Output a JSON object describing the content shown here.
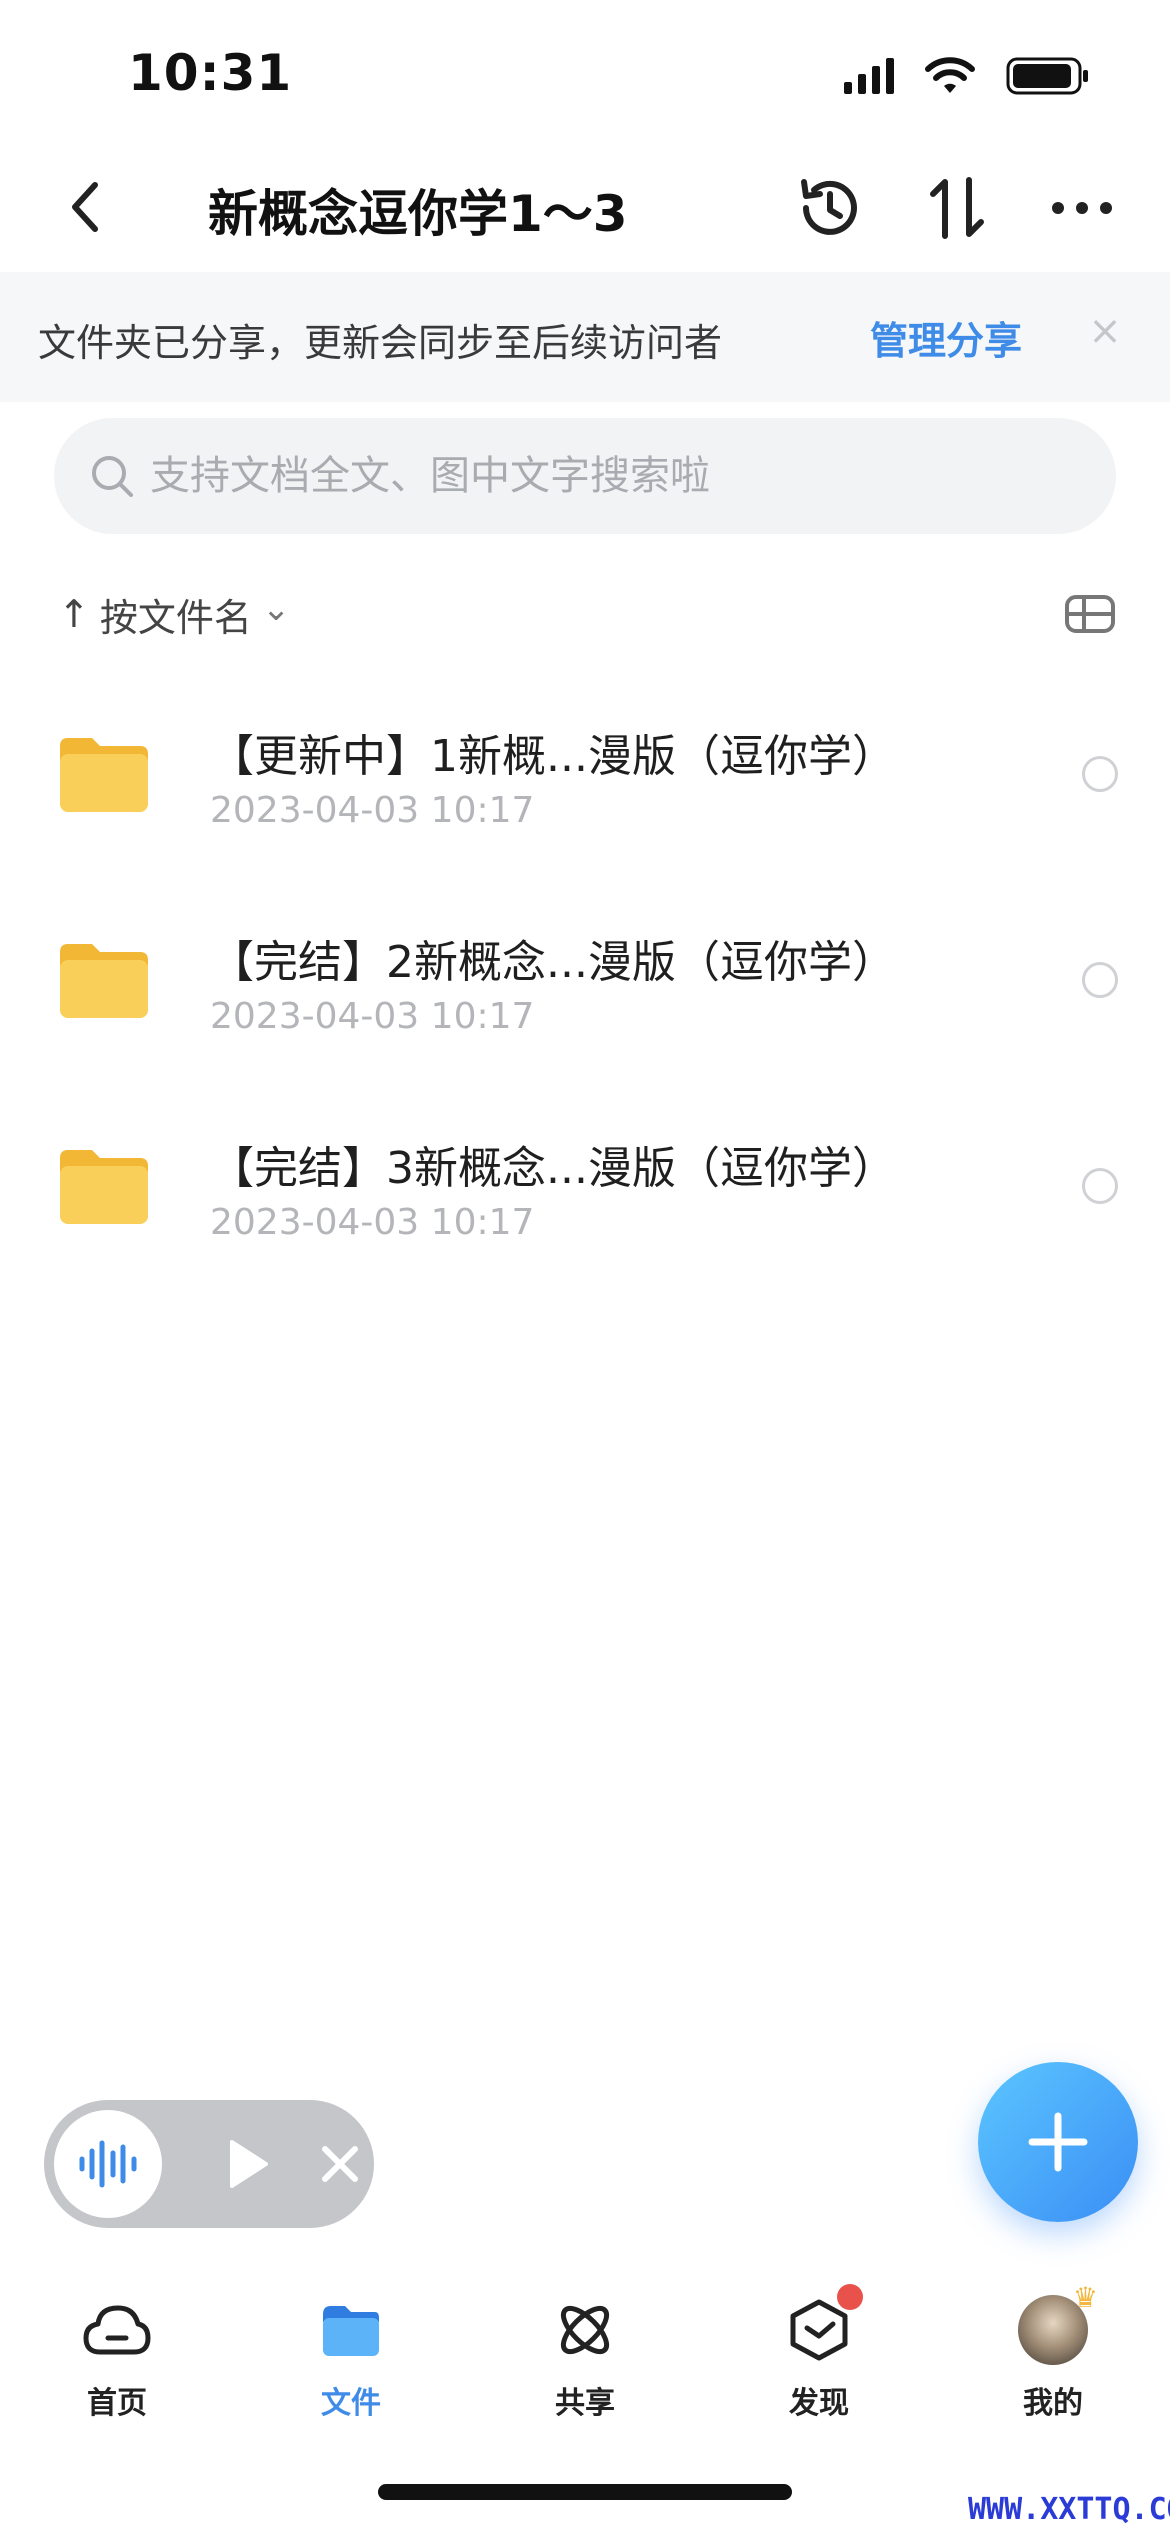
{
  "status_bar": {
    "time": "10:31"
  },
  "nav": {
    "title": "新概念逗你学1～3",
    "actions": [
      "history-icon",
      "sort-icon",
      "more-icon"
    ]
  },
  "share_banner": {
    "text": "文件夹已分享，更新会同步至后续访问者",
    "link": "管理分享",
    "close": "×"
  },
  "search": {
    "placeholder": "支持文档全文、图中文字搜索啦"
  },
  "sort": {
    "arrow": "↑",
    "label": "按文件名",
    "chevron": "⌄"
  },
  "files": [
    {
      "name": "【更新中】1新概...漫版（逗你学）",
      "date": "2023-04-03 10:17"
    },
    {
      "name": "【完结】2新概念...漫版（逗你学）",
      "date": "2023-04-03 10:17"
    },
    {
      "name": "【完结】3新概念...漫版（逗你学）",
      "date": "2023-04-03 10:17"
    }
  ],
  "tab_bar": {
    "tabs": [
      {
        "label": "首页",
        "icon": "cloud-icon"
      },
      {
        "label": "文件",
        "icon": "folder-icon",
        "active": true
      },
      {
        "label": "共享",
        "icon": "atom-icon"
      },
      {
        "label": "发现",
        "icon": "box-icon",
        "badge": true
      },
      {
        "label": "我的",
        "icon": "avatar"
      }
    ]
  },
  "colors": {
    "accent": "#3f8be8",
    "folder": "#f7c84b",
    "badge": "#e8524a"
  },
  "watermark": "WWW.XXTTQ.COM"
}
